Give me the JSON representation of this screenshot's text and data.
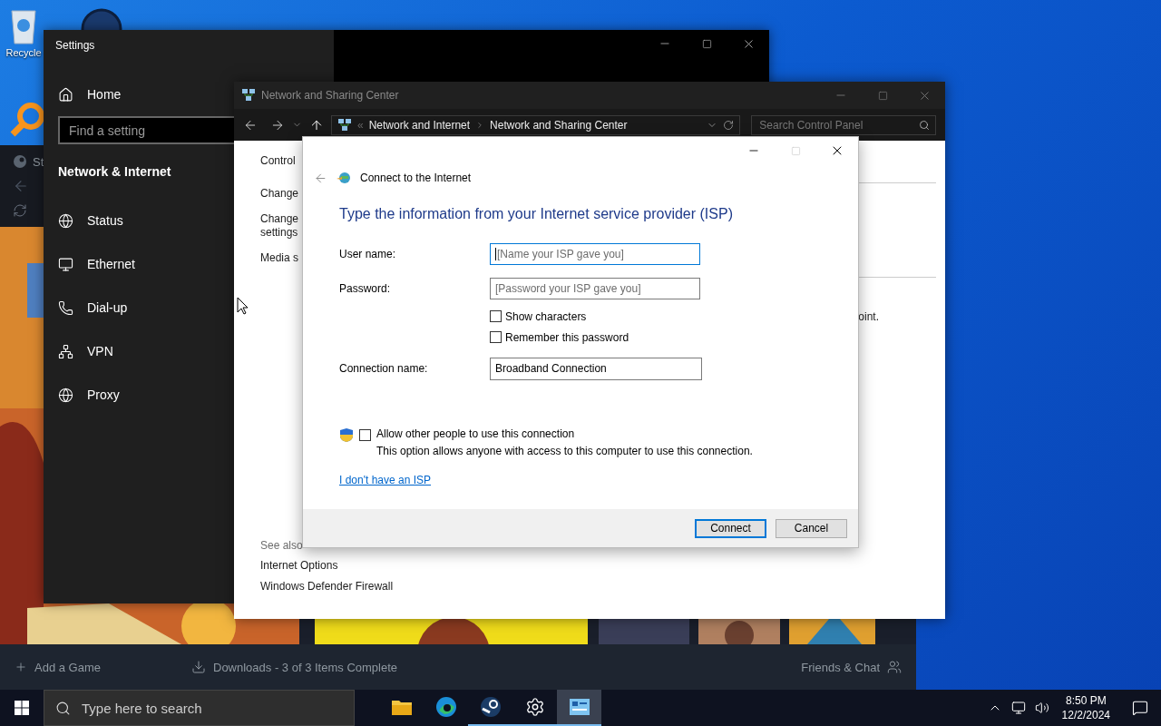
{
  "desktop": {
    "icons": [
      {
        "kind": "recycle",
        "label": "Recycle"
      },
      {
        "kind": "badge"
      },
      {
        "kind": "magnifier"
      }
    ]
  },
  "steam": {
    "title": "St",
    "footer": {
      "add_game": "Add a Game",
      "downloads": "Downloads - 3 of 3 Items Complete",
      "friends": "Friends & Chat"
    }
  },
  "settings": {
    "title": "Settings",
    "home": "Home",
    "search_placeholder": "Find a setting",
    "section": "Network & Internet",
    "items": [
      {
        "kind": "status",
        "label": "Status"
      },
      {
        "kind": "ethernet",
        "label": "Ethernet"
      },
      {
        "kind": "dialup",
        "label": "Dial-up"
      },
      {
        "kind": "vpn",
        "label": "VPN"
      },
      {
        "kind": "proxy",
        "label": "Proxy"
      }
    ]
  },
  "network_center": {
    "title": "Network and Sharing Center",
    "breadcrumb_overflow": "«",
    "breadcrumb": [
      "Network and Internet",
      "Network and Sharing Center"
    ],
    "search_placeholder": "Search Control Panel",
    "sidebar_links": [
      "Control",
      "Change",
      "Change\nsettings",
      "Media s"
    ],
    "see_also": "See also",
    "see_also_links": [
      "Internet Options",
      "Windows Defender Firewall"
    ],
    "content_fragment": "oint."
  },
  "dialog": {
    "title": "Connect to the Internet",
    "heading": "Type the information from your Internet service provider (ISP)",
    "fields": [
      {
        "label": "User name:",
        "placeholder": "[Name your ISP gave you]",
        "focused": true
      },
      {
        "label": "Password:",
        "placeholder": "[Password your ISP gave you]",
        "focused": false
      }
    ],
    "checkboxes": [
      {
        "label": "Show characters",
        "checked": false
      },
      {
        "label": "Remember this password",
        "checked": false
      }
    ],
    "connection": {
      "label": "Connection name:",
      "value": "Broadband Connection"
    },
    "allow": {
      "label": "Allow other people to use this connection",
      "description": "This option allows anyone with access to this computer to use this connection.",
      "checked": false
    },
    "link": "I don't have an ISP",
    "buttons": [
      {
        "label": "Connect",
        "default": true
      },
      {
        "label": "Cancel",
        "default": false
      }
    ]
  },
  "taskbar": {
    "search_placeholder": "Type here to search",
    "apps": [
      {
        "kind": "explorer",
        "running": false,
        "active": false
      },
      {
        "kind": "edge",
        "running": false,
        "active": false
      },
      {
        "kind": "steam",
        "running": true,
        "active": false
      },
      {
        "kind": "settings",
        "running": true,
        "active": false
      },
      {
        "kind": "control-panel",
        "running": true,
        "active": true
      }
    ],
    "time": "8:50 PM",
    "date": "12/2/2024"
  }
}
